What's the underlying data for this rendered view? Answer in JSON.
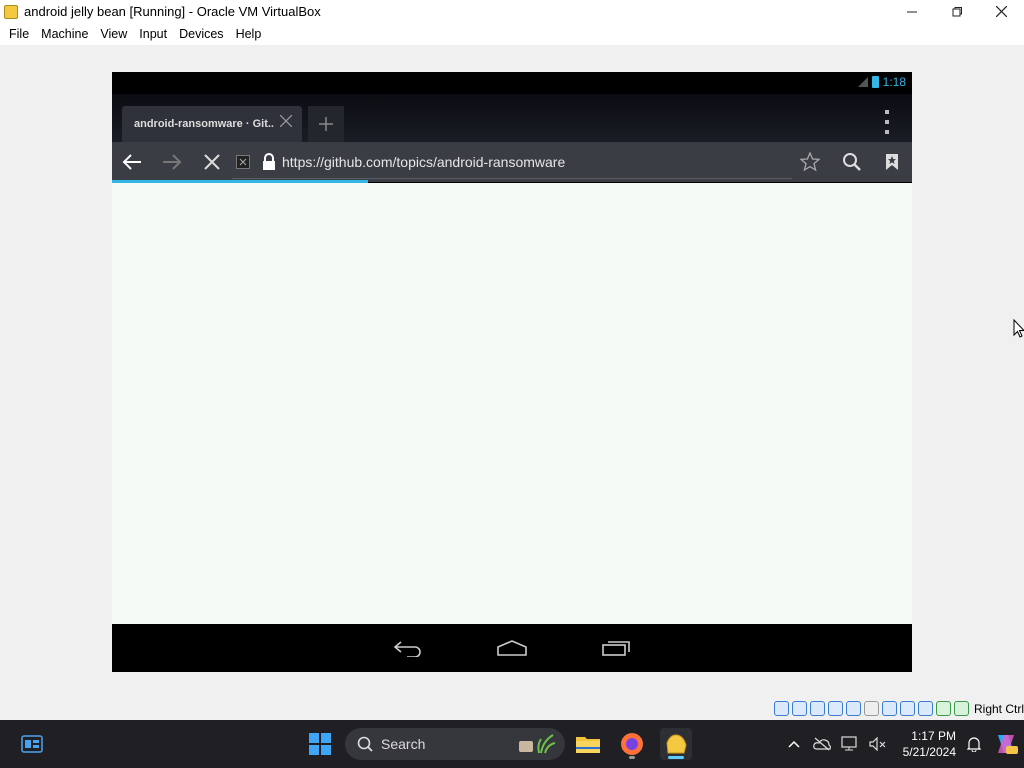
{
  "window": {
    "title": "android jelly bean [Running] - Oracle VM VirtualBox",
    "minimize_icon": "minimize-icon",
    "maximize_icon": "maximize-icon",
    "close_icon": "close-icon"
  },
  "menubar": {
    "items": [
      "File",
      "Machine",
      "View",
      "Input",
      "Devices",
      "Help"
    ]
  },
  "android": {
    "status_bar": {
      "time": "1:18",
      "accent_color": "#33b5e5"
    },
    "browser": {
      "tab_title": "android-ransomware · Git...",
      "url": "https://github.com/topics/android-ransomware",
      "load_progress": 0.32
    }
  },
  "vbox_status": {
    "host_key": "Right Ctrl"
  },
  "taskbar": {
    "search_label": "Search",
    "clock_time": "1:17 PM",
    "clock_date": "5/21/2024"
  }
}
